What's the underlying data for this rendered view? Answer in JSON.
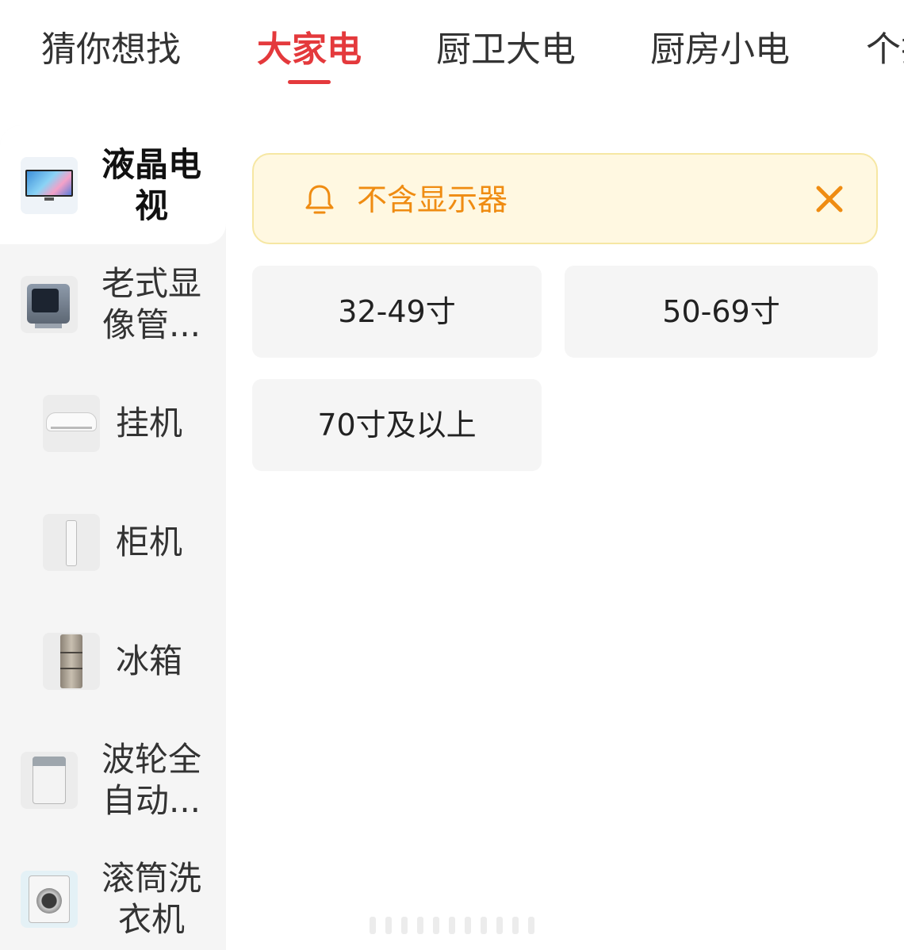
{
  "top_tabs": [
    {
      "label": "猜你想找",
      "active": false
    },
    {
      "label": "大家电",
      "active": true
    },
    {
      "label": "厨卫大电",
      "active": false
    },
    {
      "label": "厨房小电",
      "active": false
    },
    {
      "label": "个护",
      "active": false
    }
  ],
  "categories": [
    {
      "label": "液晶电视",
      "icon": "lcd-tv-thumbnail",
      "active": true
    },
    {
      "label": "老式显像管...",
      "icon": "crt-tv-thumbnail",
      "active": false
    },
    {
      "label": "挂机",
      "icon": "wall-ac-thumbnail",
      "active": false
    },
    {
      "label": "柜机",
      "icon": "floor-ac-thumbnail",
      "active": false
    },
    {
      "label": "冰箱",
      "icon": "fridge-thumbnail",
      "active": false
    },
    {
      "label": "波轮全自动...",
      "icon": "top-load-washer-thumbnail",
      "active": false
    },
    {
      "label": "滚筒洗衣机",
      "icon": "front-load-washer-thumbnail",
      "active": false
    }
  ],
  "notice": {
    "text": "不含显示器",
    "icon": "bell-icon",
    "close_icon": "close-icon",
    "text_color": "#ef8c12",
    "background": "#fff8e1"
  },
  "size_options": [
    "32-49寸",
    "50-69寸",
    "70寸及以上"
  ],
  "colors": {
    "accent": "#e4393c",
    "sidebar_bg": "#f5f5f5",
    "chip_bg": "#f5f5f5"
  }
}
